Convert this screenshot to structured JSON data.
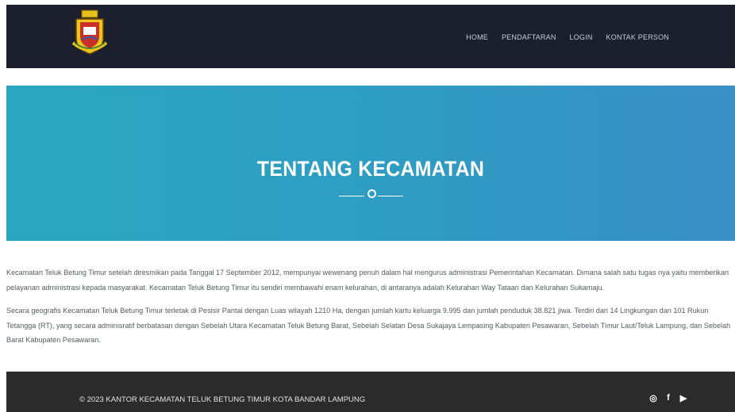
{
  "header": {
    "logo_icon": "city-emblem-icon",
    "nav": [
      "HOME",
      "PENDAFTARAN",
      "LOGIN",
      "KONTAK PERSON"
    ]
  },
  "hero": {
    "title": "TENTANG KECAMATAN"
  },
  "content": {
    "paragraphs": [
      "Kecamatan Teluk Betung Timur setelah diresmikan pada Tanggal 17 September 2012, mempunyai wewenang penuh dalam hal mengurus administrasi Pemerintahan Kecamatan. Dimana salah satu tugas nya yaitu memberikan pelayanan administrasi kepada masyarakat. Kecamatan Teluk Betung Timur itu sendiri membawahi enam kelurahan, di antaranya adalah Kelurahan Way Tataan dan Kelurahan Sukamaju.",
      "Secara geografis Kecamatan Teluk Betung Timur terletak di Pesisir Pantai dengan Luas wilayah 1210 Ha, dengan jumlah kartu keluarga 9.995 dan jumlah penduduk 38.821 jiwa. Terdiri dari 14 Lingkungan dan 101 Rukun Tetangga (RT), yang secara adminisratif berbatasan dengan Sebelah Utara Kecamatan Teluk Betung Barat, Sebelah Selatan Desa Sukajaya Lempasing Kabupaten Pesawaran, Sebelah Timur Laut/Teluk Lampung, dan Sebelah Barat Kabupaten Pesawaran."
    ]
  },
  "footer": {
    "copyright": "© 2023 KANTOR KECAMATAN TELUK BETUNG TIMUR KOTA BANDAR LAMPUNG",
    "socials": [
      {
        "icon": "instagram-icon",
        "glyph": "◎"
      },
      {
        "icon": "facebook-icon",
        "glyph": "f"
      },
      {
        "icon": "youtube-icon",
        "glyph": "▶"
      }
    ]
  }
}
